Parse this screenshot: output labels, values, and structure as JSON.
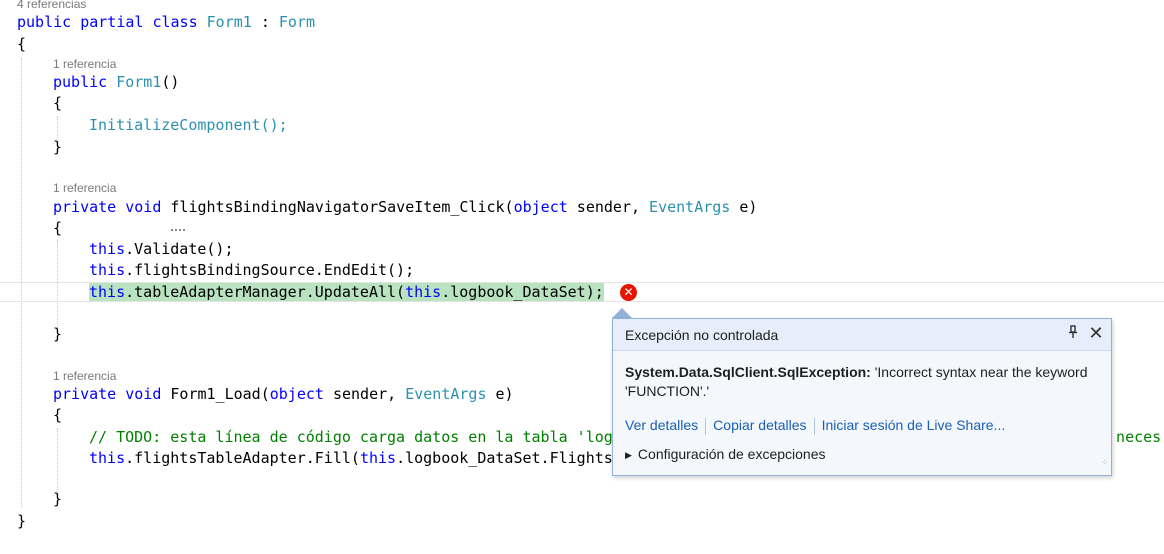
{
  "editor": {
    "class_refs": "4 referencias",
    "lines": {
      "class_decl": [
        "public",
        " ",
        "partial",
        " ",
        "class",
        " ",
        "Form1",
        " : ",
        "Form"
      ],
      "open_class": "{",
      "ref_ctor": "1 referencia",
      "ctor_decl": [
        "public",
        " ",
        "Form1",
        "()"
      ],
      "ctor_open": "{",
      "ctor_body": "InitializeComponent();",
      "ctor_close": "}",
      "ref_save": "1 referencia",
      "save_decl": [
        "private",
        " ",
        "void",
        " ",
        "flightsBindingNavigatorSaveItem_Click(",
        "object",
        " sender, ",
        "EventArgs",
        " e)"
      ],
      "save_open": "{",
      "save_l1": [
        "this",
        ".Validate();"
      ],
      "save_l2": [
        "this",
        ".flightsBindingSource.EndEdit();"
      ],
      "save_l3": [
        "this",
        ".tableAdapterManager.UpdateAll(",
        "this",
        ".logbook_DataSet);"
      ],
      "save_close": "}",
      "ref_load": "1 referencia",
      "load_decl": [
        "private",
        " ",
        "void",
        " Form1_Load(",
        "object",
        " sender, ",
        "EventArgs",
        " e)"
      ],
      "load_open": "{",
      "load_comment": "// TODO: esta línea de código carga datos en la tabla 'log",
      "load_comment_tail": "a neces",
      "load_fill": [
        "this",
        ".flightsTableAdapter.Fill(",
        "this",
        ".logbook_DataSet.Flights"
      ],
      "load_close": "}",
      "close_class": "}"
    }
  },
  "exception_popup": {
    "title": "Excepción no controlada",
    "exception_type": "System.Data.SqlClient.SqlException:",
    "message": " 'Incorrect syntax near the keyword 'FUNCTION'.'",
    "links": [
      "Ver detalles",
      "Copiar detalles",
      "Iniciar sesión de Live Share..."
    ],
    "settings_label": "Configuración de excepciones",
    "pin_icon": "pin-icon",
    "close_icon": "close-icon"
  },
  "colors": {
    "keyword": "#0000ff",
    "type": "#2b91af",
    "comment": "#008000",
    "highlight": "#b9e3c0",
    "error": "#e51400",
    "link": "#1a5fb4"
  }
}
